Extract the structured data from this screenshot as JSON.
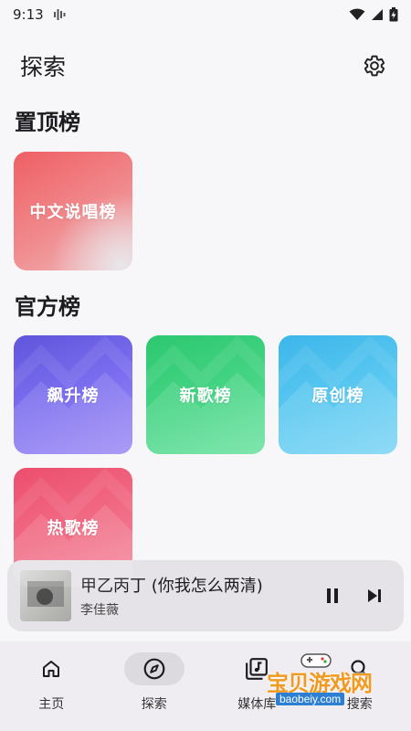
{
  "status_bar": {
    "time": "9:13"
  },
  "header": {
    "title": "探索",
    "settings_icon": "gear-icon"
  },
  "sections": {
    "pinned": {
      "title": "置顶榜",
      "items": [
        {
          "label": "中文说唱榜",
          "color": "#ee6a6f"
        }
      ]
    },
    "official": {
      "title": "官方榜",
      "items": [
        {
          "label": "飙升榜",
          "color": "#6b5ce0"
        },
        {
          "label": "新歌榜",
          "color": "#34cb7a"
        },
        {
          "label": "原创榜",
          "color": "#4fc2ee"
        },
        {
          "label": "热歌榜",
          "color": "#ef5b79"
        }
      ]
    }
  },
  "mini_player": {
    "title": "甲乙丙丁 (你我怎么两清)",
    "artist": "李佳薇"
  },
  "bottom_nav": {
    "items": [
      {
        "label": "主页",
        "icon": "home-icon"
      },
      {
        "label": "探索",
        "icon": "compass-icon",
        "active": true
      },
      {
        "label": "媒体库",
        "icon": "library-icon"
      },
      {
        "label": "搜索",
        "icon": "search-icon"
      }
    ]
  },
  "watermark": {
    "text": "宝贝游戏网",
    "url": "baobeiy.com"
  }
}
